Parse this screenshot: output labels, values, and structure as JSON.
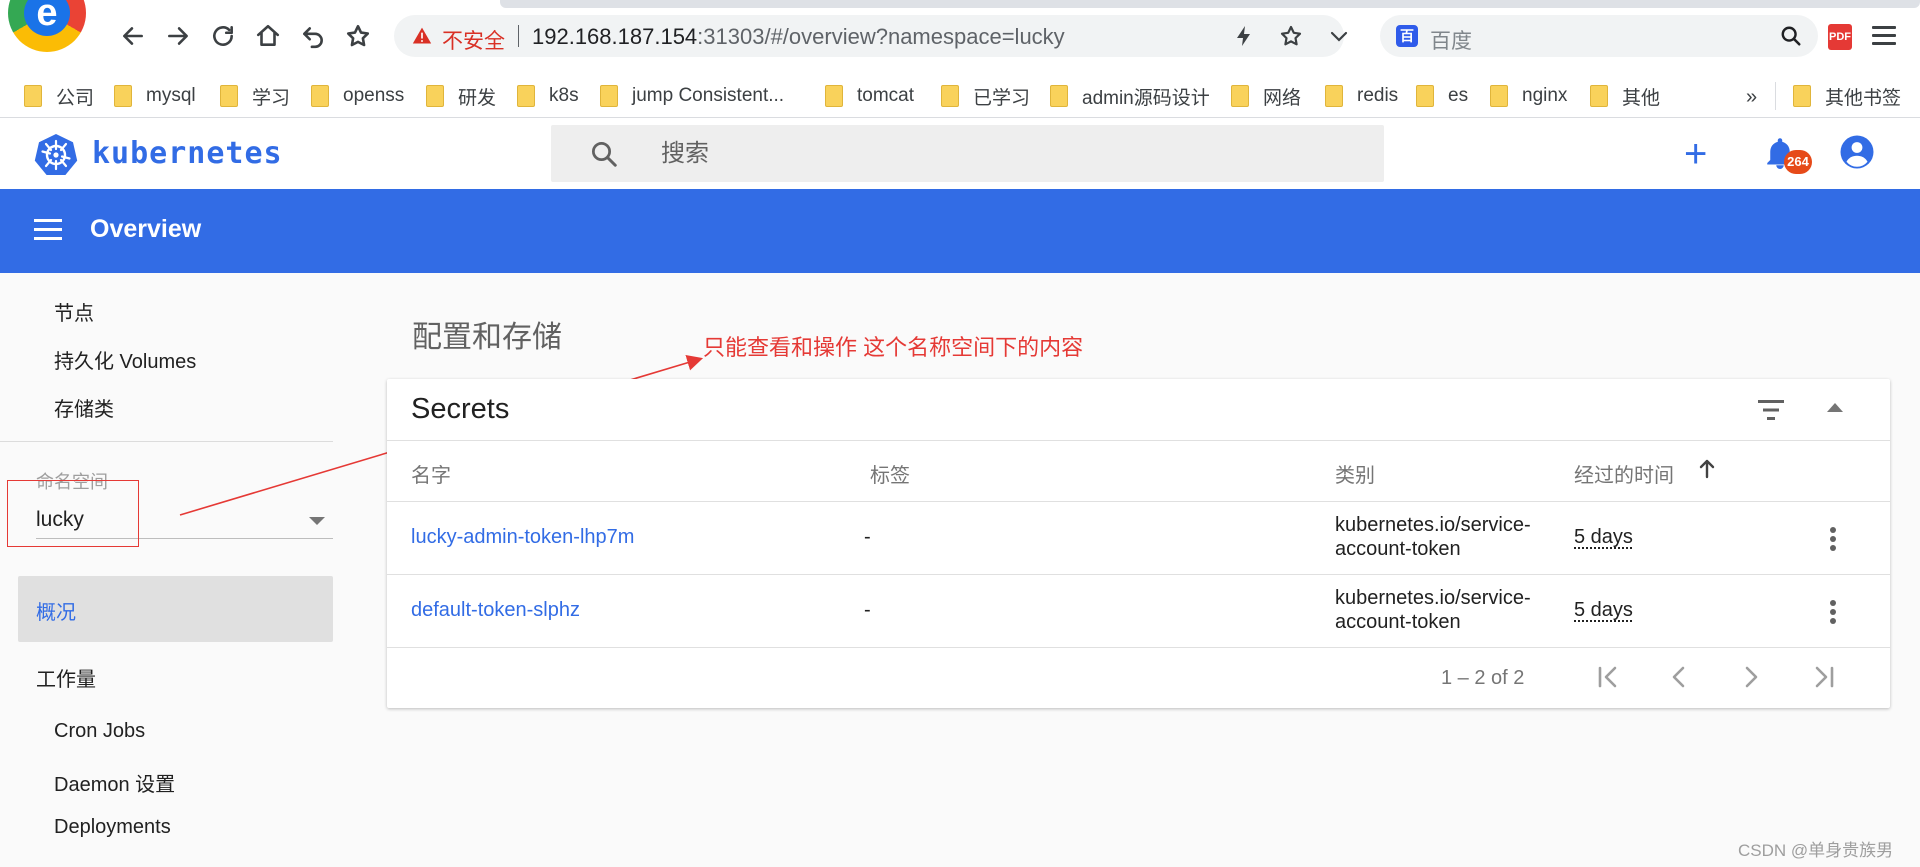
{
  "browser": {
    "logo_letter": "e",
    "insecure_label": "不安全",
    "url_host": "192.168.187.154",
    "url_rest": ":31303/#/overview?namespace=lucky",
    "search_engine_icon": "百",
    "search_engine_placeholder": "百度",
    "pdf_icon_label": "PDF"
  },
  "bookmarks": {
    "items": [
      "公司",
      "mysql",
      "学习",
      "openss",
      "研发",
      "k8s",
      "jump Consistent...",
      "tomcat",
      "已学习",
      "admin源码设计",
      "网络",
      "redis",
      "es",
      "nginx",
      "其他"
    ],
    "more": "»",
    "other_bookmarks": "其他书签"
  },
  "k8s_header": {
    "brand": "kubernetes",
    "search_placeholder": "搜索",
    "plus": "+",
    "notification_count": "264"
  },
  "toolbar": {
    "title": "Overview"
  },
  "sidebar": {
    "storage_items": [
      "节点",
      "持久化 Volumes",
      "存储类"
    ],
    "namespace_label": "命名空间",
    "namespace_value": "lucky",
    "overview_label": "概况",
    "workloads_label": "工作量",
    "workload_items": [
      "Cron Jobs",
      "Daemon 设置",
      "Deployments"
    ]
  },
  "main": {
    "section_title": "配置和存储",
    "annotation": "只能查看和操作 这个名称空间下的内容",
    "card_title": "Secrets",
    "columns": [
      "名字",
      "标签",
      "类别",
      "经过的时间"
    ],
    "rows": [
      {
        "name": "lucky-admin-token-lhp7m",
        "labels": "-",
        "type_line1": "kubernetes.io/service-",
        "type_line2": "account-token",
        "age": "5 days"
      },
      {
        "name": "default-token-slphz",
        "labels": "-",
        "type_line1": "kubernetes.io/service-",
        "type_line2": "account-token",
        "age": "5 days"
      }
    ],
    "pagination": "1 – 2 of 2"
  },
  "colors": {
    "k8s_blue": "#326ce5",
    "annotation_red": "#e53935"
  },
  "watermark": "CSDN @单身贵族男"
}
